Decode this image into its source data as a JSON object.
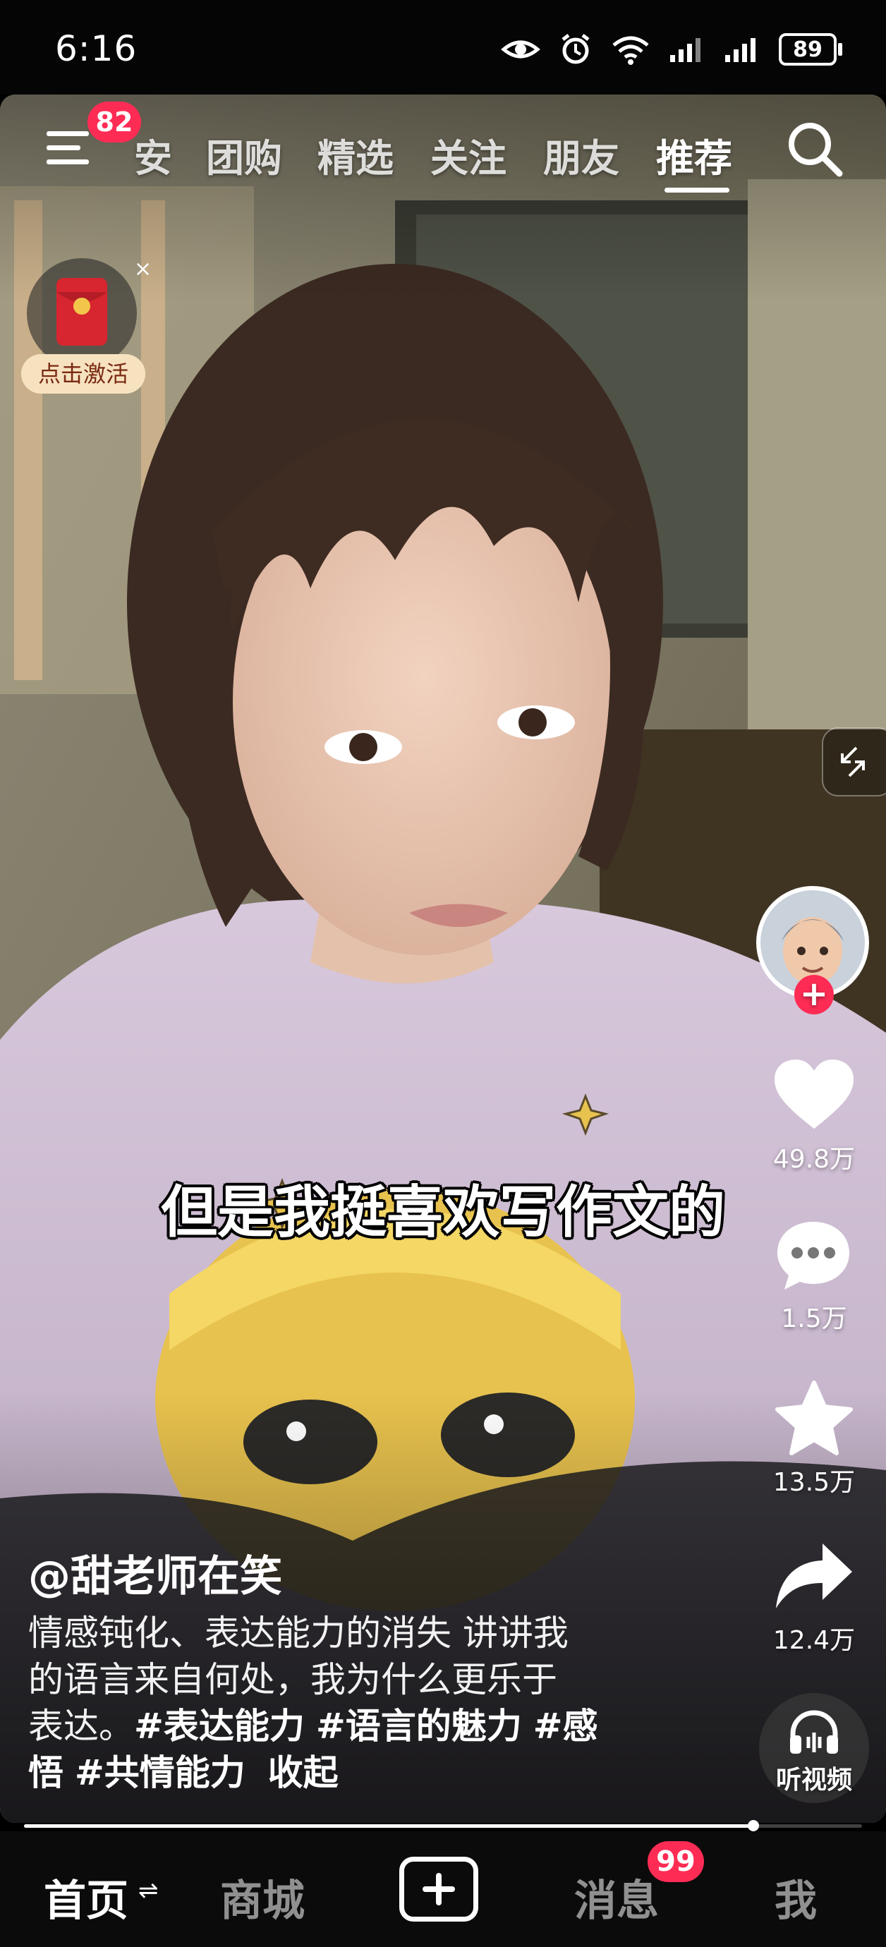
{
  "status_bar": {
    "time": "6:16",
    "battery": "89"
  },
  "top_nav": {
    "menu_badge": "82",
    "tabs": [
      "安",
      "团购",
      "精选",
      "关注",
      "朋友",
      "推荐"
    ],
    "active_tab": "推荐"
  },
  "red_packet": {
    "label": "点击激活"
  },
  "video": {
    "subtitle": "但是我挺喜欢写作文的",
    "progress": 0.87
  },
  "actions": {
    "likes": "49.8万",
    "comments": "1.5万",
    "favorites": "13.5万",
    "shares": "12.4万",
    "listen_label": "听视频"
  },
  "post": {
    "author": "@甜老师在笑",
    "desc_line1": "情感钝化、表达能力的消失 讲讲我",
    "desc_line2": "的语言来自何处，我为什么更乐于",
    "desc_line3_text": "表达。",
    "hashtags": [
      "#表达能力",
      "#语言的魅力",
      "#感",
      "悟",
      "#共情能力"
    ],
    "collapse": "收起"
  },
  "bottom_nav": {
    "home": "首页",
    "mall": "商城",
    "messages": "消息",
    "messages_badge": "99",
    "me": "我"
  },
  "colors": {
    "accent": "#fe2c55"
  }
}
